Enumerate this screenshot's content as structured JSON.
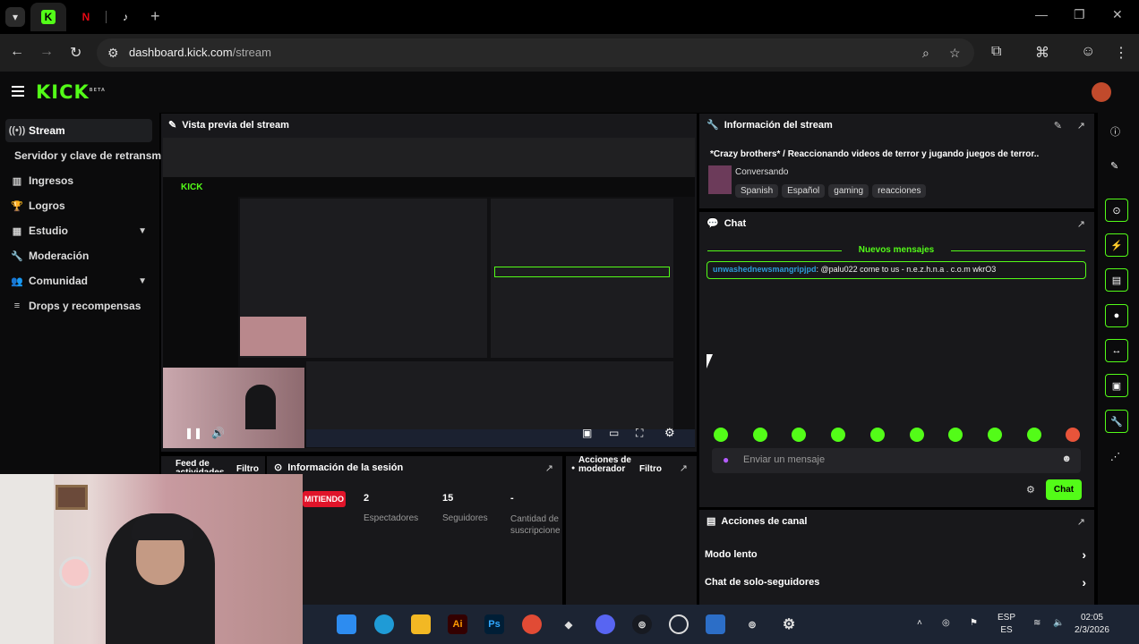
{
  "browser": {
    "tabs": [
      {
        "name": "kick",
        "label": "K",
        "color": "#53fc18"
      },
      {
        "name": "netflix",
        "label": "N",
        "color": "#e50914"
      },
      {
        "name": "tiktok",
        "label": "♪",
        "color": "#ffffff"
      }
    ],
    "url_host": "dashboard.kick.com",
    "url_path": "/stream"
  },
  "kick": {
    "logo": "KICK",
    "logo_badge": "BETA"
  },
  "sidebar": {
    "items": [
      {
        "label": "Stream",
        "icon": "broadcast-icon",
        "glyph": "((•))"
      },
      {
        "label": "Servidor y clave de retransm",
        "icon": "",
        "glyph": ""
      },
      {
        "label": "Ingresos",
        "icon": "chart-icon",
        "glyph": "▥"
      },
      {
        "label": "Logros",
        "icon": "trophy-icon",
        "glyph": "🏆"
      },
      {
        "label": "Estudio",
        "icon": "studio-icon",
        "glyph": "▦"
      },
      {
        "label": "Moderación",
        "icon": "wrench-icon",
        "glyph": "🔧"
      },
      {
        "label": "Comunidad",
        "icon": "community-icon",
        "glyph": "👥"
      },
      {
        "label": "Drops y recompensas",
        "icon": "drops-icon",
        "glyph": "≡"
      }
    ]
  },
  "panels": {
    "preview_title": "Vista previa del stream",
    "info_title": "Información del stream",
    "stream_title": "*Crazy brothers* / Reaccionando videos de terror y jugando juegos de terror..",
    "category": "Conversando",
    "tags": [
      "Spanish",
      "Español",
      "gaming",
      "reacciones"
    ],
    "chat_title": "Chat",
    "new_messages": "Nuevos mensajes",
    "chat_user": "unwashednewsmangripjpd",
    "chat_text": ": @palu022 come to us - n.e.z.h.n.a . c.o.m wkrO3",
    "chat_placeholder": "Enviar un mensaje",
    "chat_button": "Chat",
    "channel_actions_title": "Acciones de canal",
    "slow_mode": "Modo lento",
    "followers_only": "Chat de solo-seguidores",
    "activity_feed_title": "Feed de actividades",
    "filter": "Filtro",
    "session_title": "Información de la sesión",
    "live_badge": "MITIENDO",
    "viewers_value": "2",
    "viewers_label": "Espectadores",
    "followers_value": "15",
    "followers_label": "Seguidores",
    "subs_value": "-",
    "subs_label": "Cantidad de suscripcione",
    "mod_actions_title": "Acciones de moderador",
    "filter2": "Filtro"
  },
  "taskbar": {
    "lang_top": "ESP",
    "lang_bottom": "ES",
    "time": "02:05",
    "date": "2/3/2026"
  },
  "colors": {
    "accent": "#53fc18",
    "panel": "#18181b",
    "background": "#0b0b0c"
  }
}
